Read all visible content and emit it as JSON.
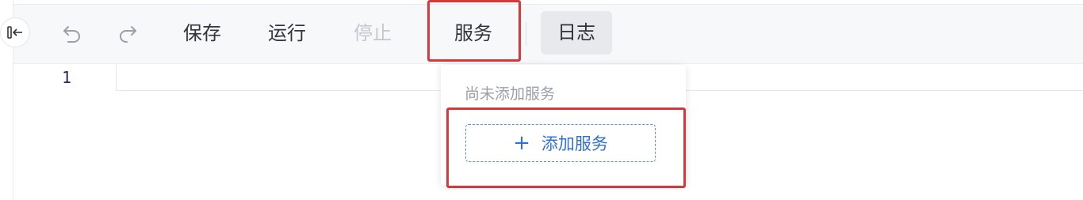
{
  "toolbar": {
    "save_label": "保存",
    "run_label": "运行",
    "stop_label": "停止",
    "service_label": "服务",
    "log_label": "日志"
  },
  "editor": {
    "line_number": "1"
  },
  "service_dropdown": {
    "empty_text": "尚未添加服务",
    "add_button_label": "添加服务",
    "add_icon": "+"
  },
  "colors": {
    "highlight": "#d9383a",
    "accent": "#2f6fde"
  }
}
